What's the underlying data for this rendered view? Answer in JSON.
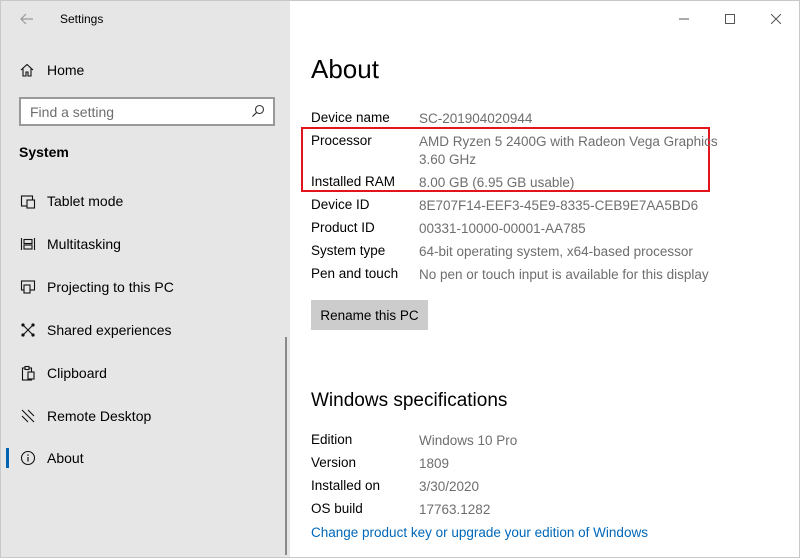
{
  "window": {
    "title": "Settings"
  },
  "sidebar": {
    "home_label": "Home",
    "search_placeholder": "Find a setting",
    "section_title": "System",
    "items": [
      {
        "label": "Tablet mode",
        "icon": "tablet-mode-icon"
      },
      {
        "label": "Multitasking",
        "icon": "multitasking-icon"
      },
      {
        "label": "Projecting to this PC",
        "icon": "projecting-icon"
      },
      {
        "label": "Shared experiences",
        "icon": "shared-experiences-icon"
      },
      {
        "label": "Clipboard",
        "icon": "clipboard-icon"
      },
      {
        "label": "Remote Desktop",
        "icon": "remote-desktop-icon"
      },
      {
        "label": "About",
        "icon": "info-icon",
        "selected": true
      }
    ]
  },
  "about": {
    "title": "About",
    "device_specs": [
      {
        "key": "Device name",
        "value": "SC-201904020944"
      },
      {
        "key": "Processor",
        "value": "AMD Ryzen 5 2400G with Radeon Vega Graphics",
        "value2": "3.60 GHz"
      },
      {
        "key": "Installed RAM",
        "value": "8.00 GB (6.95 GB usable)"
      },
      {
        "key": "Device ID",
        "value": "8E707F14-EEF3-45E9-8335-CEB9E7AA5BD6"
      },
      {
        "key": "Product ID",
        "value": "00331-10000-00001-AA785"
      },
      {
        "key": "System type",
        "value": "64-bit operating system, x64-based processor"
      },
      {
        "key": "Pen and touch",
        "value": "No pen or touch input is available for this display"
      }
    ],
    "rename_button": "Rename this PC",
    "windows_specs_title": "Windows specifications",
    "windows_specs": [
      {
        "key": "Edition",
        "value": "Windows 10 Pro"
      },
      {
        "key": "Version",
        "value": "1809"
      },
      {
        "key": "Installed on",
        "value": "3/30/2020"
      },
      {
        "key": "OS build",
        "value": "17763.1282"
      }
    ],
    "change_key_link": "Change product key or upgrade your edition of Windows"
  },
  "colors": {
    "accent": "#0063b1",
    "link": "#0067b8",
    "highlight": "#e3151c",
    "sidebar_bg": "#e6e6e6"
  }
}
